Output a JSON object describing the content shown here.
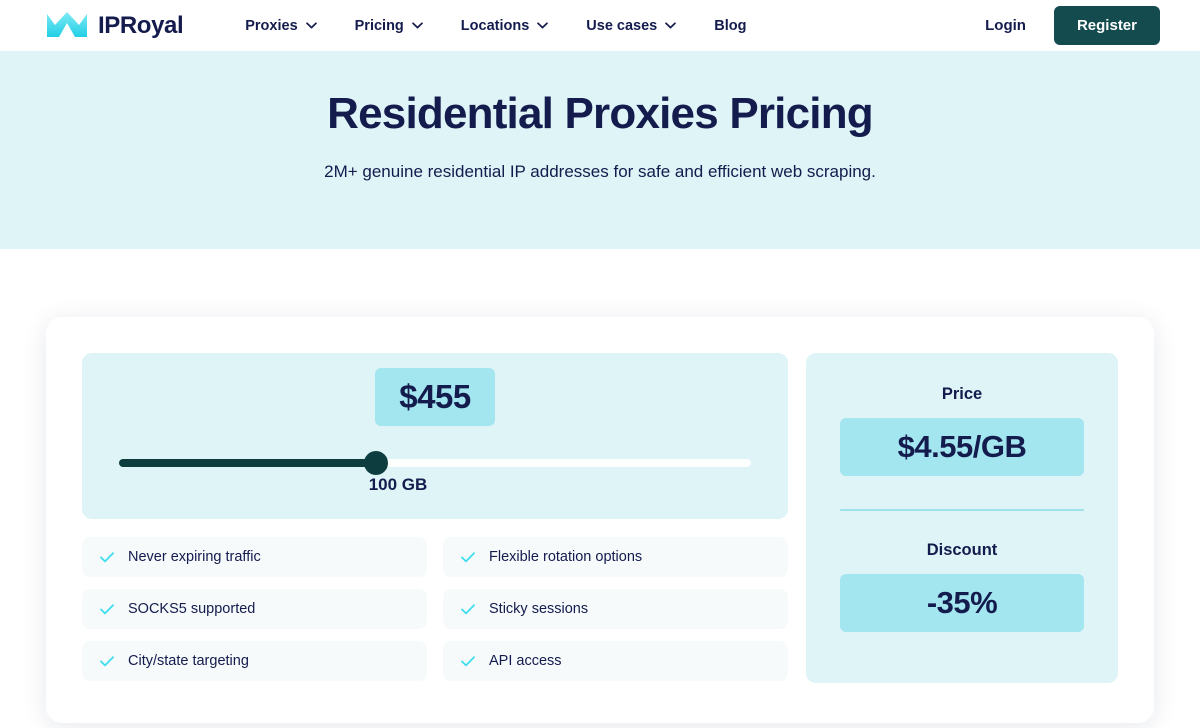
{
  "header": {
    "brand_name": "IPRoyal",
    "logo_icon": "crown-logo-icon",
    "nav": [
      {
        "label": "Proxies",
        "has_dropdown": true,
        "icon": "chevron-down-icon"
      },
      {
        "label": "Pricing",
        "has_dropdown": true,
        "icon": "chevron-down-icon"
      },
      {
        "label": "Locations",
        "has_dropdown": true,
        "icon": "chevron-down-icon"
      },
      {
        "label": "Use cases",
        "has_dropdown": true,
        "icon": "chevron-down-icon"
      },
      {
        "label": "Blog",
        "has_dropdown": false,
        "icon": ""
      }
    ],
    "login_label": "Login",
    "register_label": "Register"
  },
  "hero": {
    "title": "Residential Proxies Pricing",
    "subtitle": "2M+ genuine residential IP addresses for safe and efficient web scraping.",
    "background_color": "#DEF4F7"
  },
  "calculator": {
    "total_price": "$455",
    "slider": {
      "value_label": "100 GB",
      "fill_percent": 40,
      "track_color": "#FDFEFE",
      "fill_color": "#0E3D40",
      "thumb_color": "#0E3D40"
    },
    "features": [
      {
        "label": "Never expiring traffic",
        "icon": "check-icon"
      },
      {
        "label": "Flexible rotation options",
        "icon": "check-icon"
      },
      {
        "label": "SOCKS5 supported",
        "icon": "check-icon"
      },
      {
        "label": "Sticky sessions",
        "icon": "check-icon"
      },
      {
        "label": "City/state targeting",
        "icon": "check-icon"
      },
      {
        "label": "API access",
        "icon": "check-icon"
      }
    ],
    "summary": {
      "price_label": "Price",
      "price_value": "$4.55/GB",
      "discount_label": "Discount",
      "discount_value": "-35%"
    }
  },
  "colors": {
    "brand_navy": "#141B4D",
    "accent_cyan": "#3FDDEE",
    "panel_bg": "#DEF4F7",
    "value_bg": "#A3E6EF",
    "cta_teal": "#134B4F"
  }
}
